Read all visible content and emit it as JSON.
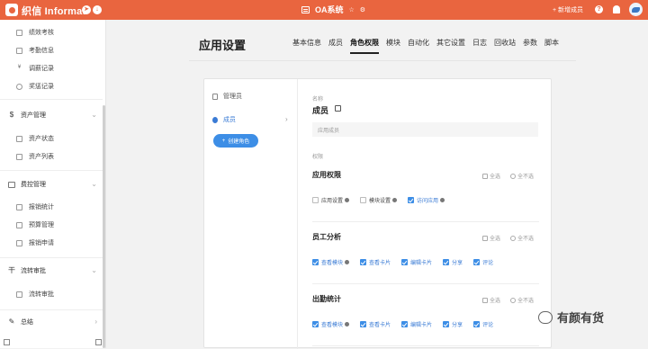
{
  "topbar": {
    "brand": "织信 Informat",
    "app_title": "OA系统",
    "add_member_label": "+ 新增成员",
    "help_icon": "question-icon",
    "bell_icon": "bell-icon"
  },
  "sidebar": {
    "items_top": [
      {
        "label": "绩效考核",
        "icon": "file-icon",
        "glyph": "▫"
      },
      {
        "label": "考勤信息",
        "icon": "file-icon",
        "glyph": "▫"
      },
      {
        "label": "调薪记录",
        "icon": "yen-icon",
        "glyph": "¥"
      },
      {
        "label": "奖惩记录",
        "icon": "award-icon",
        "glyph": "○"
      }
    ],
    "groups": [
      {
        "label": "资产管理",
        "icon": "dollar-icon",
        "glyph": "$"
      },
      {
        "label": "费控管理",
        "icon": "card-icon",
        "glyph": "▭"
      },
      {
        "label": "流转审批",
        "icon": "stamp-icon",
        "glyph": "干"
      },
      {
        "label": "总结",
        "icon": "edit-icon",
        "glyph": "✎"
      }
    ],
    "asset_items": [
      {
        "label": "资产状态",
        "icon": "chart-icon"
      },
      {
        "label": "资产列表",
        "icon": "table-icon"
      }
    ],
    "fee_items": [
      {
        "label": "报销统计",
        "icon": "chart-icon"
      },
      {
        "label": "预算管理",
        "icon": "table-icon"
      },
      {
        "label": "报销申请",
        "icon": "table-icon"
      }
    ],
    "flow_items": [
      {
        "label": "流转审批",
        "icon": "table-icon"
      }
    ]
  },
  "page": {
    "title": "应用设置",
    "tabs": [
      "基本信息",
      "成员",
      "角色权限",
      "模块",
      "自动化",
      "其它设置",
      "日志",
      "回收站",
      "参数",
      "脚本"
    ],
    "active_tab": "角色权限"
  },
  "roles": {
    "items": [
      {
        "label": "管理员"
      },
      {
        "label": "成员"
      }
    ],
    "active": "成员",
    "create_button": "创建角色"
  },
  "detail": {
    "name_label": "名称",
    "name_value": "成员",
    "name_input_value": "应用成员",
    "perm_label": "权限",
    "select_all": "全选",
    "select_none": "全不选",
    "sections": [
      {
        "title": "应用权限",
        "options": [
          {
            "label": "应用设置",
            "checked": false,
            "info": true
          },
          {
            "label": "模块设置",
            "checked": false,
            "info": true
          },
          {
            "label": "访问应用",
            "checked": true,
            "info": true
          }
        ]
      },
      {
        "title": "员工分析",
        "options": [
          {
            "label": "查看模块",
            "checked": true,
            "info": true
          },
          {
            "label": "查看卡片",
            "checked": true,
            "info": false
          },
          {
            "label": "编辑卡片",
            "checked": true,
            "info": false
          },
          {
            "label": "分享",
            "checked": true,
            "info": false
          },
          {
            "label": "评论",
            "checked": true,
            "info": false
          }
        ]
      },
      {
        "title": "出勤统计",
        "options": [
          {
            "label": "查看模块",
            "checked": true,
            "info": true
          },
          {
            "label": "查看卡片",
            "checked": true,
            "info": false
          },
          {
            "label": "编辑卡片",
            "checked": true,
            "info": false
          },
          {
            "label": "分享",
            "checked": true,
            "info": false
          },
          {
            "label": "评论",
            "checked": true,
            "info": false
          }
        ]
      }
    ]
  },
  "watermark": {
    "text": "有颜有货"
  },
  "colors": {
    "brand": "#e9653f",
    "accent": "#3d8ee6"
  }
}
